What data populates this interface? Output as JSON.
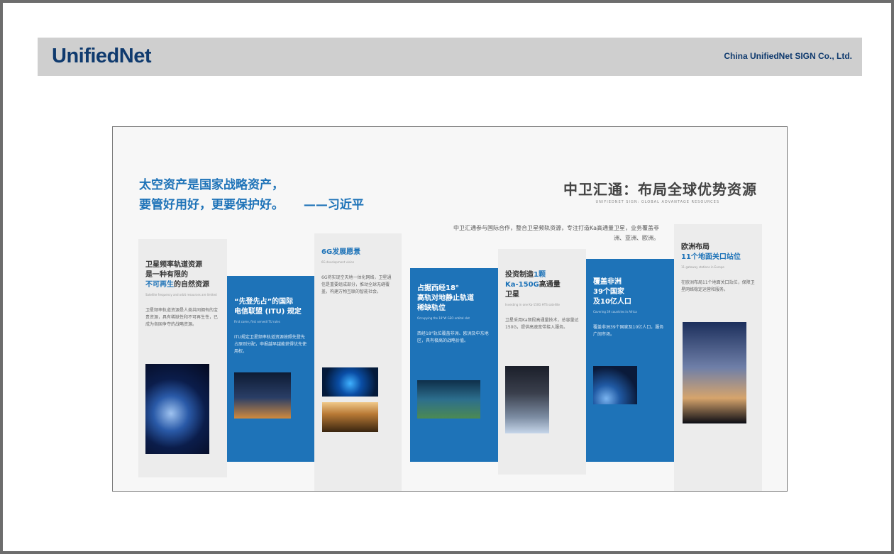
{
  "header": {
    "logo": "UnifiedNet",
    "company": "China UnifiedNet SIGN Co., Ltd."
  },
  "board": {
    "quote_line1": "太空资产是国家战略资产，",
    "quote_line2": "要管好用好，更要保护好。",
    "quote_author": "——习近平",
    "title": "中卫汇通：布局全球优势资源",
    "subtitle": "UNIFIEDNET SIGN: GLOBAL ADVANTAGE RESOURCES",
    "description": "中卫汇通参与国际合作，整合卫星频轨资源，专注打造Ka高通量卫星，业务覆盖非洲、亚洲、欧洲。",
    "panels": [
      {
        "title_line1": "卫星频率轨道资源",
        "title_line2": "是一种有限的",
        "title_highlight": "不可再生",
        "title_line3_rest": "的自然资源",
        "tiny": "Satellite frequency and orbit resources are limited",
        "body": "卫星频率轨道资源是人类共同拥有的宝贵资源，具有稀缺性和不可再生性，已成为各国争夺的战略资源。"
      },
      {
        "title_line1": "“先登先占”的国际",
        "title_line2": "电信联盟 (ITU) 规定",
        "tiny": "First come, first served ITU rules",
        "body": "ITU规定卫星频率轨道资源按照先登先占原则分配，申报越早越能获得优先使用权。"
      },
      {
        "title_line1": "6G发展愿景",
        "tiny": "6G development vision",
        "body": "6G将实现空天地一体化网络，卫星通信是重要组成部分，推动全球无缝覆盖，构建万物互联的智能社会。"
      },
      {
        "title_line1": "占据西经18°",
        "title_line2": "高轨对地静止轨道",
        "title_line3": "稀缺轨位",
        "tiny": "Occupying the 18°W GEO orbital slot",
        "body": "西经18°轨位覆盖非洲、欧洲及中东地区，具有极高的战略价值。"
      },
      {
        "title_line1": "投资制造",
        "title_highlight1": "1颗",
        "title_line2": "Ka-150G",
        "title_line2_rest": "高通量",
        "title_line3": "卫星",
        "tiny": "Investing in one Ka-150G HTS satellite",
        "body": "卫星采用Ka频段高通量技术，总容量达150G，提供高速宽带接入服务。"
      },
      {
        "title_line1": "覆盖非洲",
        "title_line2": "39个国家",
        "title_line3": "及10亿人口",
        "tiny": "Covering 39 countries in Africa",
        "body": "覆盖非洲39个国家及10亿人口，服务广阔市场。"
      },
      {
        "title_line1": "欧洲布局",
        "title_line2": "11个地面关口站位",
        "tiny": "11 gateway stations in Europe",
        "body": "在欧洲布局11个地面关口站位，保障卫星网络稳定运营和服务。"
      }
    ]
  }
}
